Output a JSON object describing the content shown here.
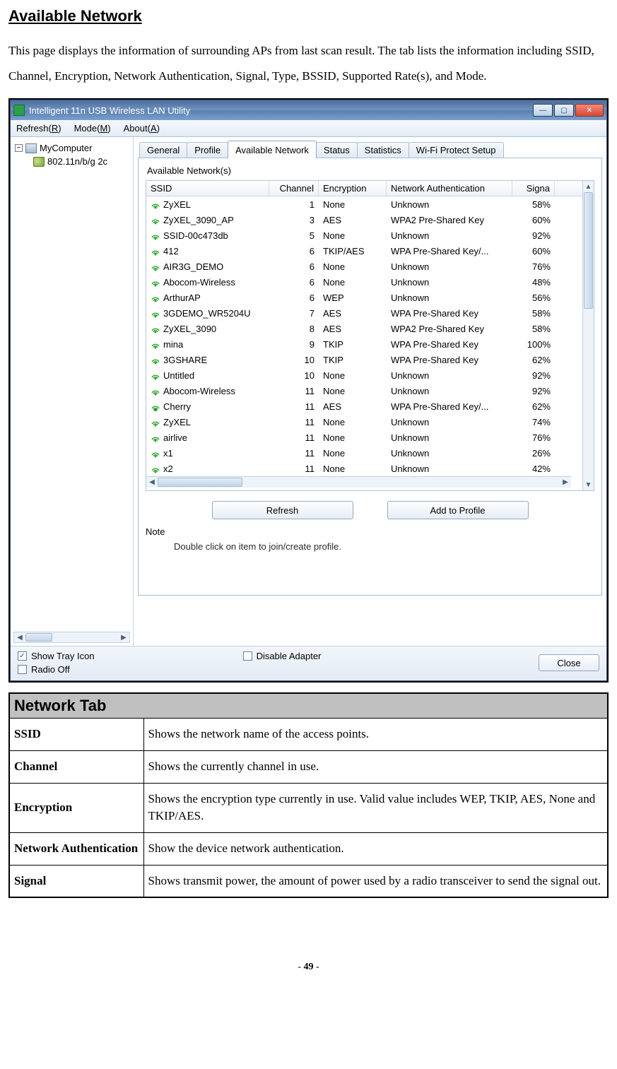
{
  "doc": {
    "sectionTitle": "Available Network",
    "intro": "This page displays the information of surrounding APs from last scan result. The tab lists the information including SSID, Channel, Encryption, Network Authentication, Signal, Type, BSSID, Supported Rate(s), and Mode.",
    "pageNumPrefix": "- ",
    "pageNum": "49",
    "pageNumSuffix": " -"
  },
  "app": {
    "title": "Intelligent 11n USB Wireless LAN Utility",
    "menu": {
      "refresh": "Refresh(",
      "refreshKey": "R",
      "mode": "Mode(",
      "modeKey": "M",
      "about": "About(",
      "aboutKey": "A",
      "close": ")"
    },
    "tree": {
      "root": "MyComputer",
      "child": "802.11n/b/g 2c"
    },
    "tabs": [
      "General",
      "Profile",
      "Available Network",
      "Status",
      "Statistics",
      "Wi-Fi Protect Setup"
    ],
    "activeTab": 2,
    "groupLabel": "Available Network(s)",
    "listHeaders": {
      "ssid": "SSID",
      "channel": "Channel",
      "encryption": "Encryption",
      "auth": "Network Authentication",
      "signal": "Signa"
    },
    "networks": [
      {
        "ssid": "ZyXEL",
        "ch": "1",
        "enc": "None",
        "auth": "Unknown",
        "sig": "58%",
        "conn": false
      },
      {
        "ssid": "ZyXEL_3090_AP",
        "ch": "3",
        "enc": "AES",
        "auth": "WPA2 Pre-Shared Key",
        "sig": "60%",
        "conn": false
      },
      {
        "ssid": "SSID-00c473db",
        "ch": "5",
        "enc": "None",
        "auth": "Unknown",
        "sig": "92%",
        "conn": false
      },
      {
        "ssid": "412",
        "ch": "6",
        "enc": "TKIP/AES",
        "auth": "WPA Pre-Shared Key/...",
        "sig": "60%",
        "conn": false
      },
      {
        "ssid": "AIR3G_DEMO",
        "ch": "6",
        "enc": "None",
        "auth": "Unknown",
        "sig": "76%",
        "conn": false
      },
      {
        "ssid": "Abocom-Wireless",
        "ch": "6",
        "enc": "None",
        "auth": "Unknown",
        "sig": "48%",
        "conn": false
      },
      {
        "ssid": "ArthurAP",
        "ch": "6",
        "enc": "WEP",
        "auth": "Unknown",
        "sig": "56%",
        "conn": false
      },
      {
        "ssid": "3GDEMO_WR5204U",
        "ch": "7",
        "enc": "AES",
        "auth": "WPA Pre-Shared Key",
        "sig": "58%",
        "conn": false
      },
      {
        "ssid": "ZyXEL_3090",
        "ch": "8",
        "enc": "AES",
        "auth": "WPA2 Pre-Shared Key",
        "sig": "58%",
        "conn": false
      },
      {
        "ssid": "mina",
        "ch": "9",
        "enc": "TKIP",
        "auth": "WPA Pre-Shared Key",
        "sig": "100%",
        "conn": false
      },
      {
        "ssid": "3GSHARE",
        "ch": "10",
        "enc": "TKIP",
        "auth": "WPA Pre-Shared Key",
        "sig": "62%",
        "conn": false
      },
      {
        "ssid": "Untitled",
        "ch": "10",
        "enc": "None",
        "auth": "Unknown",
        "sig": "92%",
        "conn": false
      },
      {
        "ssid": "Abocom-Wireless",
        "ch": "11",
        "enc": "None",
        "auth": "Unknown",
        "sig": "92%",
        "conn": false
      },
      {
        "ssid": "Cherry",
        "ch": "11",
        "enc": "AES",
        "auth": "WPA Pre-Shared Key/...",
        "sig": "62%",
        "conn": true
      },
      {
        "ssid": "ZyXEL",
        "ch": "11",
        "enc": "None",
        "auth": "Unknown",
        "sig": "74%",
        "conn": false
      },
      {
        "ssid": "airlive",
        "ch": "11",
        "enc": "None",
        "auth": "Unknown",
        "sig": "76%",
        "conn": false
      },
      {
        "ssid": "x1",
        "ch": "11",
        "enc": "None",
        "auth": "Unknown",
        "sig": "26%",
        "conn": false
      },
      {
        "ssid": "x2",
        "ch": "11",
        "enc": "None",
        "auth": "Unknown",
        "sig": "42%",
        "conn": false
      }
    ],
    "buttons": {
      "refresh": "Refresh",
      "addProfile": "Add to Profile"
    },
    "note": {
      "label": "Note",
      "text": "Double click on item to join/create profile."
    },
    "bottom": {
      "showTray": "Show Tray Icon",
      "showTrayChecked": true,
      "radioOff": "Radio Off",
      "radioOffChecked": false,
      "disableAdapter": "Disable Adapter",
      "disableAdapterChecked": false,
      "close": "Close"
    }
  },
  "table": {
    "header": "Network Tab",
    "rows": [
      {
        "label": "SSID",
        "desc": "Shows the network name of the access points."
      },
      {
        "label": "Channel",
        "desc": "Shows the currently channel in use."
      },
      {
        "label": "Encryption",
        "desc": "Shows the encryption type currently in use. Valid value includes WEP, TKIP, AES, None and TKIP/AES."
      },
      {
        "label": "Network Authentication",
        "desc": "Show the device network authentication."
      },
      {
        "label": "Signal",
        "desc": "Shows transmit power, the amount of power used by a radio transceiver to send the signal out."
      }
    ]
  }
}
